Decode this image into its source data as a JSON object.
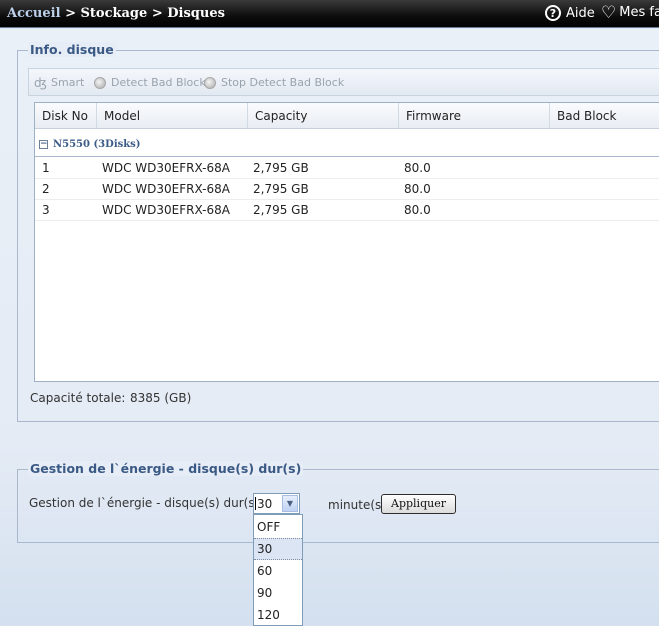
{
  "breadcrumb": {
    "home": "Accueil",
    "separator": ">",
    "section": "Stockage",
    "page": "Disques"
  },
  "header": {
    "help_label": "Aide",
    "help_icon": "?",
    "favorites_label": "Mes fa"
  },
  "disk_info": {
    "legend": "Info. disque",
    "toolbar": [
      {
        "label": "Smart",
        "icon": "smart-icon"
      },
      {
        "label": "Detect Bad Block",
        "icon": "play-icon"
      },
      {
        "label": "Stop Detect Bad Block",
        "icon": "stop-icon"
      }
    ],
    "columns": [
      "Disk No",
      "Model",
      "Capacity",
      "Firmware",
      "Bad Block"
    ],
    "group": {
      "toggle": "−",
      "label": "N5550 (3Disks)"
    },
    "rows": [
      {
        "disk_no": "1",
        "model": "WDC WD30EFRX-68A",
        "capacity": "2,795 GB",
        "firmware": "80.0",
        "bad_block": ""
      },
      {
        "disk_no": "2",
        "model": "WDC WD30EFRX-68A",
        "capacity": "2,795 GB",
        "firmware": "80.0",
        "bad_block": ""
      },
      {
        "disk_no": "3",
        "model": "WDC WD30EFRX-68A",
        "capacity": "2,795 GB",
        "firmware": "80.0",
        "bad_block": ""
      }
    ],
    "total_label": "Capacité totale:",
    "total_value": "8385 (GB)"
  },
  "power": {
    "legend": "Gestion de l`énergie - disque(s) dur(s)",
    "field_label": "Gestion de l`énergie - disque(s) dur(s):",
    "selected": "30",
    "unit": "minute(s)",
    "apply_label": "Appliquer",
    "options": [
      "OFF",
      "30",
      "60",
      "90",
      "120"
    ],
    "highlighted_option": "30"
  }
}
